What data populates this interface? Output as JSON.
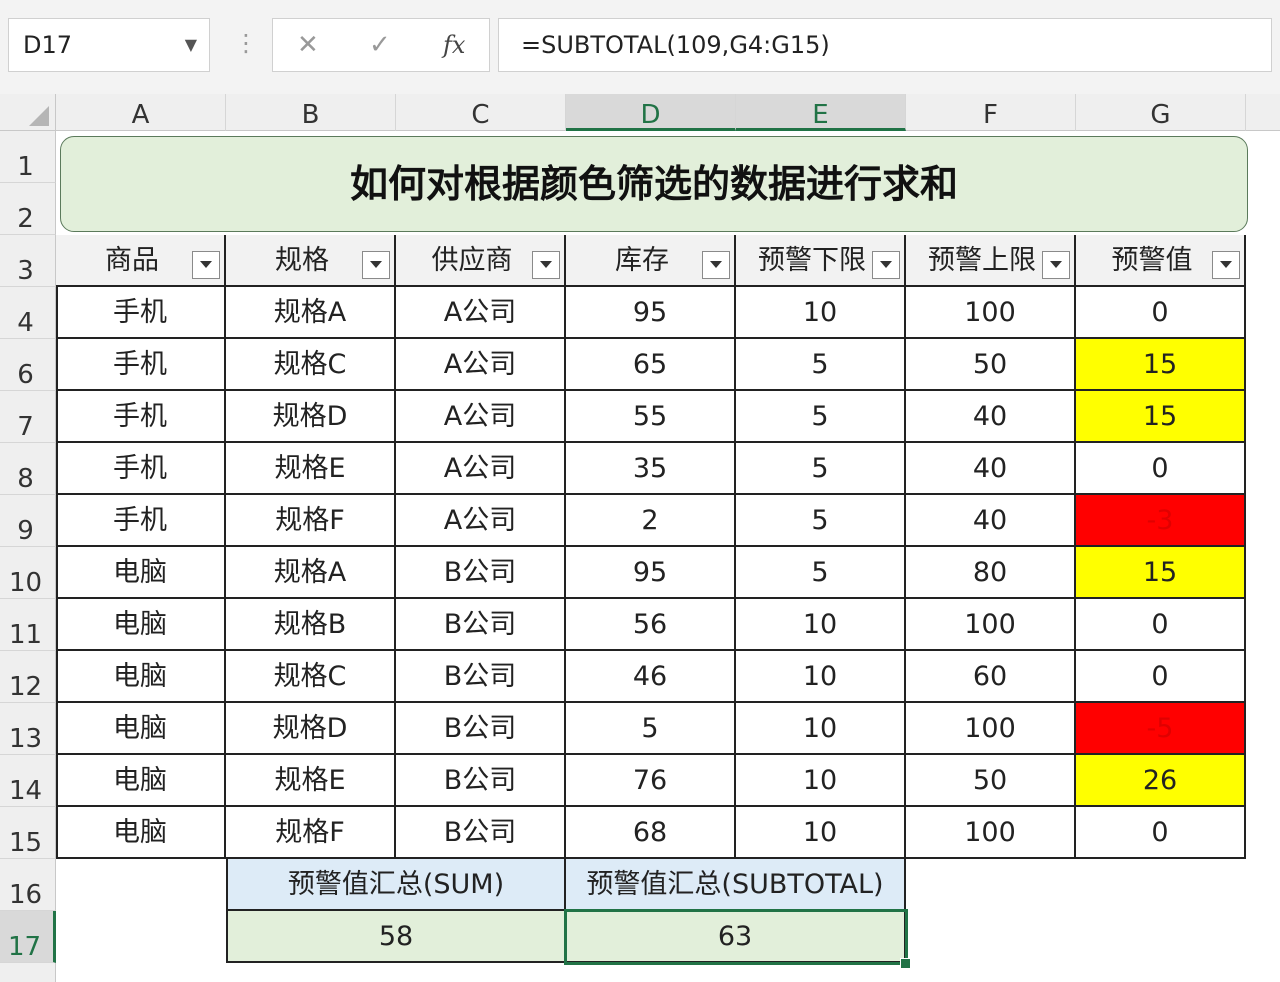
{
  "formula_bar": {
    "name_box": "D17",
    "formula": "=SUBTOTAL(109,G4:G15)",
    "fx_label": "fx"
  },
  "columns": [
    "A",
    "B",
    "C",
    "D",
    "E",
    "F",
    "G"
  ],
  "rows": [
    "1",
    "2",
    "3",
    "4",
    "6",
    "7",
    "8",
    "9",
    "10",
    "11",
    "12",
    "13",
    "14",
    "15",
    "16",
    "17"
  ],
  "title": "如何对根据颜色筛选的数据进行求和",
  "table": {
    "headers": [
      "商品",
      "规格",
      "供应商",
      "库存",
      "预警下限",
      "预警上限",
      "预警值"
    ],
    "rows": [
      [
        "手机",
        "规格A",
        "A公司",
        "95",
        "10",
        "100",
        "0"
      ],
      [
        "手机",
        "规格C",
        "A公司",
        "65",
        "5",
        "50",
        "15"
      ],
      [
        "手机",
        "规格D",
        "A公司",
        "55",
        "5",
        "40",
        "15"
      ],
      [
        "手机",
        "规格E",
        "A公司",
        "35",
        "5",
        "40",
        "0"
      ],
      [
        "手机",
        "规格F",
        "A公司",
        "2",
        "5",
        "40",
        "-3"
      ],
      [
        "电脑",
        "规格A",
        "B公司",
        "95",
        "5",
        "80",
        "15"
      ],
      [
        "电脑",
        "规格B",
        "B公司",
        "56",
        "10",
        "100",
        "0"
      ],
      [
        "电脑",
        "规格C",
        "B公司",
        "46",
        "10",
        "60",
        "0"
      ],
      [
        "电脑",
        "规格D",
        "B公司",
        "5",
        "10",
        "100",
        "-5"
      ],
      [
        "电脑",
        "规格E",
        "B公司",
        "76",
        "10",
        "50",
        "26"
      ],
      [
        "电脑",
        "规格F",
        "B公司",
        "68",
        "10",
        "100",
        "0"
      ]
    ],
    "g_fill": [
      "none",
      "yellow",
      "yellow",
      "none",
      "red",
      "yellow",
      "none",
      "none",
      "red",
      "yellow",
      "none"
    ]
  },
  "summary": {
    "sum_label": "预警值汇总(SUM)",
    "subtotal_label": "预警值汇总(SUBTOTAL)",
    "sum_value": "58",
    "subtotal_value": "63"
  },
  "colors": {
    "yellow": "#ffff00",
    "red": "#ff0000",
    "selection": "#217346",
    "title_fill": "#e2efda",
    "sum_header_fill": "#ddebf7",
    "sum_value_fill": "#e2efda"
  }
}
